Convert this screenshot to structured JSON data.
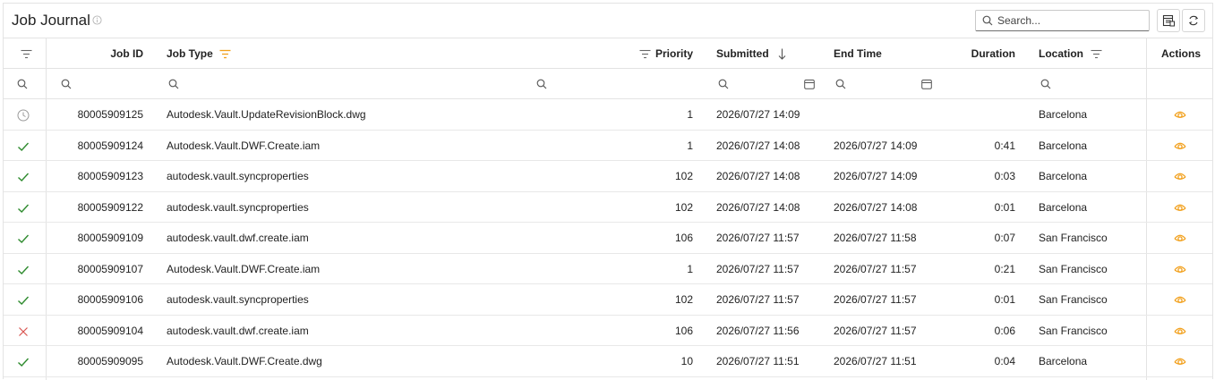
{
  "header": {
    "title": "Job Journal",
    "search_placeholder": "Search..."
  },
  "columns": {
    "job_id": "Job ID",
    "job_type": "Job Type",
    "priority": "Priority",
    "submitted": "Submitted",
    "end_time": "End Time",
    "duration": "Duration",
    "location": "Location",
    "actions": "Actions"
  },
  "colors": {
    "accent": "#f2a01c",
    "success": "#2e8b2e",
    "error": "#d9534f",
    "pending": "#9a9a9a"
  },
  "rows": [
    {
      "status": "pending",
      "job_id": "80005909125",
      "job_type": "Autodesk.Vault.UpdateRevisionBlock.dwg",
      "priority": "1",
      "submitted": "2026/07/27 14:09",
      "end_time": "",
      "duration": "",
      "location": "Barcelona"
    },
    {
      "status": "success",
      "job_id": "80005909124",
      "job_type": "Autodesk.Vault.DWF.Create.iam",
      "priority": "1",
      "submitted": "2026/07/27 14:08",
      "end_time": "2026/07/27 14:09",
      "duration": "0:41",
      "location": "Barcelona"
    },
    {
      "status": "success",
      "job_id": "80005909123",
      "job_type": "autodesk.vault.syncproperties",
      "priority": "102",
      "submitted": "2026/07/27 14:08",
      "end_time": "2026/07/27 14:09",
      "duration": "0:03",
      "location": "Barcelona"
    },
    {
      "status": "success",
      "job_id": "80005909122",
      "job_type": "autodesk.vault.syncproperties",
      "priority": "102",
      "submitted": "2026/07/27 14:08",
      "end_time": "2026/07/27 14:08",
      "duration": "0:01",
      "location": "Barcelona"
    },
    {
      "status": "success",
      "job_id": "80005909109",
      "job_type": "autodesk.vault.dwf.create.iam",
      "priority": "106",
      "submitted": "2026/07/27 11:57",
      "end_time": "2026/07/27 11:58",
      "duration": "0:07",
      "location": "San Francisco"
    },
    {
      "status": "success",
      "job_id": "80005909107",
      "job_type": "Autodesk.Vault.DWF.Create.iam",
      "priority": "1",
      "submitted": "2026/07/27 11:57",
      "end_time": "2026/07/27 11:57",
      "duration": "0:21",
      "location": "San Francisco"
    },
    {
      "status": "success",
      "job_id": "80005909106",
      "job_type": "autodesk.vault.syncproperties",
      "priority": "102",
      "submitted": "2026/07/27 11:57",
      "end_time": "2026/07/27 11:57",
      "duration": "0:01",
      "location": "San Francisco"
    },
    {
      "status": "error",
      "job_id": "80005909104",
      "job_type": "autodesk.vault.dwf.create.iam",
      "priority": "106",
      "submitted": "2026/07/27 11:56",
      "end_time": "2026/07/27 11:57",
      "duration": "0:06",
      "location": "San Francisco"
    },
    {
      "status": "success",
      "job_id": "80005909095",
      "job_type": "Autodesk.Vault.DWF.Create.dwg",
      "priority": "10",
      "submitted": "2026/07/27 11:51",
      "end_time": "2026/07/27 11:51",
      "duration": "0:04",
      "location": "Barcelona"
    }
  ]
}
